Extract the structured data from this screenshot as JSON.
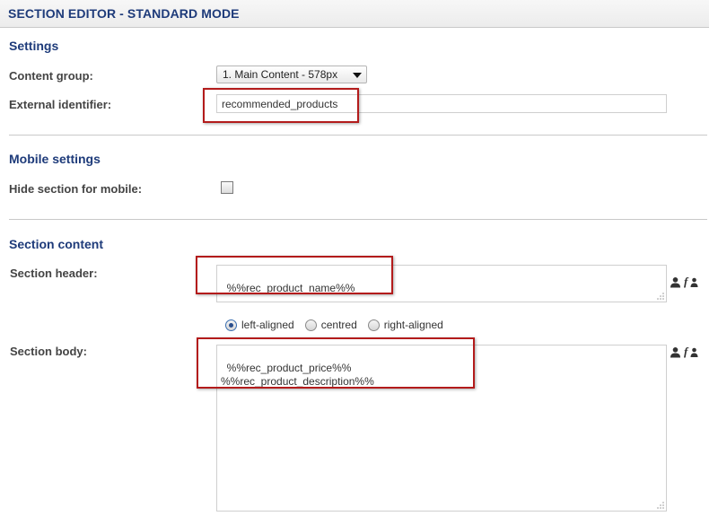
{
  "editor": {
    "title": "SECTION EDITOR - STANDARD MODE"
  },
  "settings": {
    "heading": "Settings",
    "content_group_label": "Content group:",
    "content_group_value": "1. Main Content - 578px",
    "external_identifier_label": "External identifier:",
    "external_identifier_value": "recommended_products"
  },
  "mobile": {
    "heading": "Mobile settings",
    "hide_label": "Hide section for mobile:",
    "hide_checked": false
  },
  "content": {
    "heading": "Section content",
    "header_label": "Section header:",
    "header_value": "%%rec_product_name%%",
    "alignment_options": [
      "left-aligned",
      "centred",
      "right-aligned"
    ],
    "alignment_selected": "left-aligned",
    "body_label": "Section body:",
    "body_value": "%%rec_product_price%%\n%%rec_product_description%%"
  },
  "colors": {
    "heading": "#1e3b7a",
    "highlight": "#b31b1b"
  },
  "icons": [
    "user-icon",
    "function-icon"
  ]
}
